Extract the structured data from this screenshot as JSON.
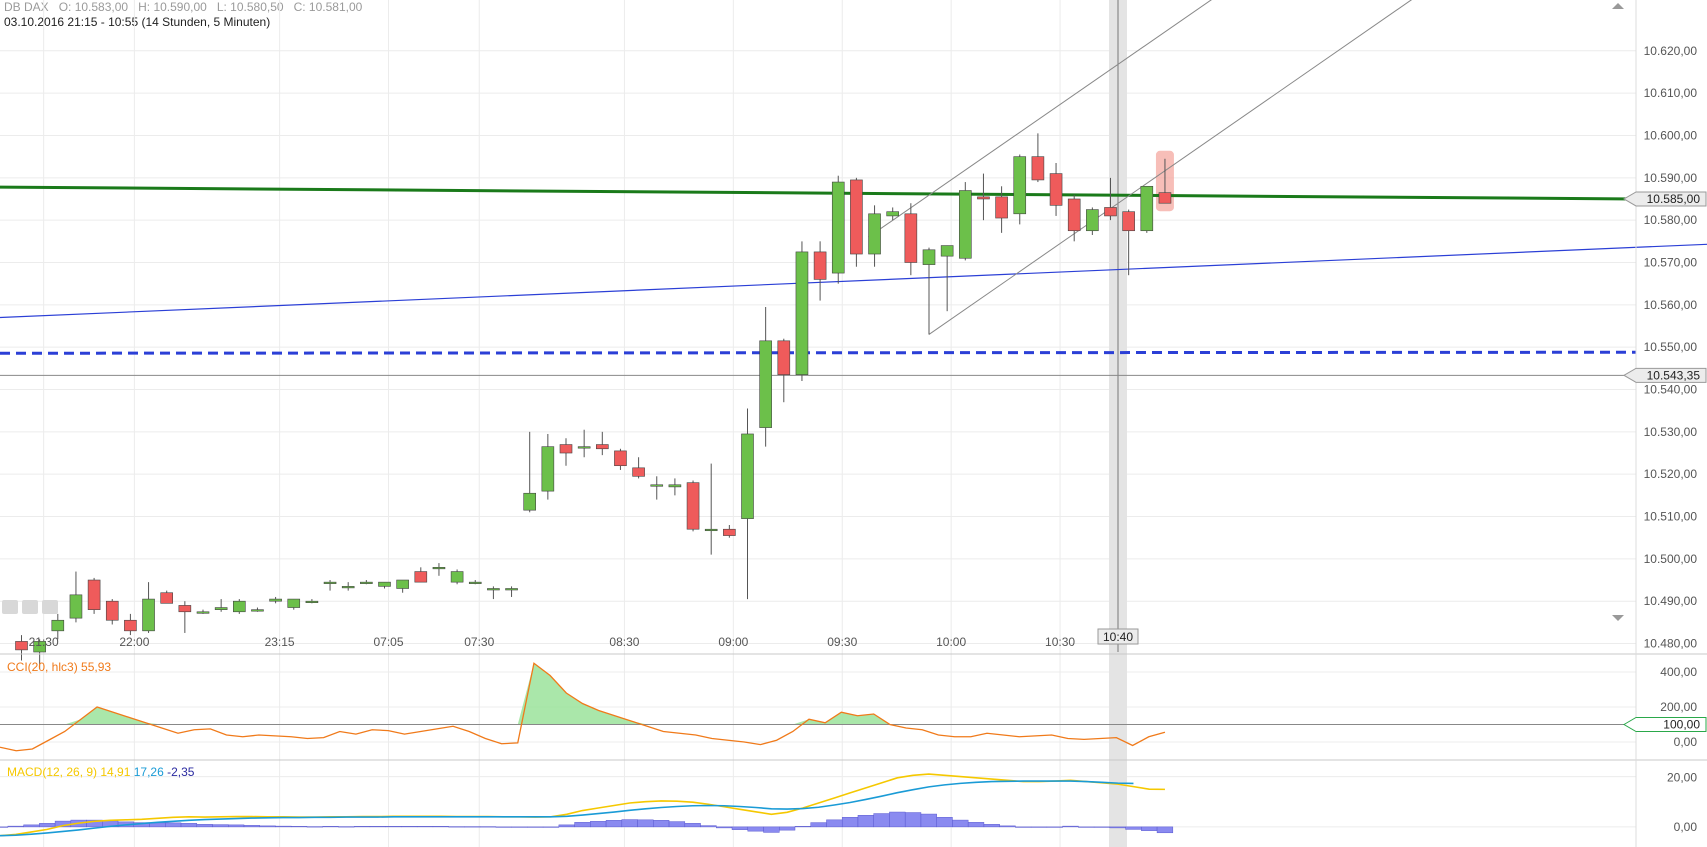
{
  "header": {
    "symbol": "DB DAX",
    "open": "O: 10.583,00",
    "high": "H: 10.590,00",
    "low": "L: 10.580,50",
    "close": "C: 10.581,00",
    "range": "03.10.2016 21:15 - 10:55 (14 Stunden, 5 Minuten)"
  },
  "colors": {
    "up": "#6cc04a",
    "down": "#ef5b5b",
    "grid": "#ececec",
    "support": "#1a7a1a",
    "trend": "#2b3fd6",
    "cci": "#f07a1a",
    "cci_fill": "#9be39b",
    "macd": "#f5c800",
    "signal": "#1a9bd6",
    "hist": "#8a8af0"
  },
  "markers": {
    "crosshair_time": "10:40",
    "price_labels": [
      "10.585,00",
      "10.543,35"
    ],
    "cci_level_label": "100,00"
  },
  "chart_data": [
    {
      "type": "candlestick",
      "interval": "5 Minuten",
      "x_labels": [
        "21:30",
        "22:00",
        "23:15",
        "07:05",
        "07:30",
        "08:30",
        "09:00",
        "09:30",
        "10:00",
        "10:30"
      ],
      "y_ticks": [
        "10.480,00",
        "10.490,00",
        "10.500,00",
        "10.510,00",
        "10.520,00",
        "10.530,00",
        "10.540,00",
        "10.550,00",
        "10.560,00",
        "10.570,00",
        "10.580,00",
        "10.590,00",
        "10.600,00",
        "10.610,00",
        "10.620,00"
      ],
      "ylim": [
        10478,
        10632
      ],
      "candles": [
        {
          "o": 10480.5,
          "h": 10482,
          "l": 10476,
          "c": 10478.5
        },
        {
          "o": 10478,
          "h": 10481,
          "l": 10474,
          "c": 10480.5
        },
        {
          "o": 10483,
          "h": 10487,
          "l": 10481,
          "c": 10485.5
        },
        {
          "o": 10486,
          "h": 10497,
          "l": 10485,
          "c": 10491.5
        },
        {
          "o": 10495,
          "h": 10495.5,
          "l": 10487,
          "c": 10488
        },
        {
          "o": 10490,
          "h": 10490.5,
          "l": 10484.5,
          "c": 10485.5
        },
        {
          "o": 10485.5,
          "h": 10487,
          "l": 10482,
          "c": 10483
        },
        {
          "o": 10483,
          "h": 10494.5,
          "l": 10482.5,
          "c": 10490.5
        },
        {
          "o": 10492,
          "h": 10492.5,
          "l": 10489.5,
          "c": 10489.5
        },
        {
          "o": 10489,
          "h": 10490,
          "l": 10482.5,
          "c": 10487.5
        },
        {
          "o": 10487.5,
          "h": 10488,
          "l": 10487,
          "c": 10487.5
        },
        {
          "o": 10488,
          "h": 10490.5,
          "l": 10487.5,
          "c": 10488.5
        },
        {
          "o": 10487.5,
          "h": 10490.5,
          "l": 10487,
          "c": 10490
        },
        {
          "o": 10488,
          "h": 10488.5,
          "l": 10487.5,
          "c": 10488
        },
        {
          "o": 10490,
          "h": 10491,
          "l": 10489.5,
          "c": 10490.5
        },
        {
          "o": 10488.5,
          "h": 10490.5,
          "l": 10488,
          "c": 10490.5
        },
        {
          "o": 10490,
          "h": 10490.5,
          "l": 10489.5,
          "c": 10490
        },
        {
          "o": 10494.5,
          "h": 10495,
          "l": 10492.5,
          "c": 10494.5
        },
        {
          "o": 10493.5,
          "h": 10494.5,
          "l": 10492.5,
          "c": 10493.5
        },
        {
          "o": 10494.5,
          "h": 10495,
          "l": 10494,
          "c": 10494.5
        },
        {
          "o": 10493.5,
          "h": 10494.5,
          "l": 10493,
          "c": 10494.5
        },
        {
          "o": 10493,
          "h": 10495,
          "l": 10492,
          "c": 10495
        },
        {
          "o": 10497,
          "h": 10498,
          "l": 10494.5,
          "c": 10494.5
        },
        {
          "o": 10498,
          "h": 10499,
          "l": 10496,
          "c": 10498
        },
        {
          "o": 10494.5,
          "h": 10497.5,
          "l": 10494,
          "c": 10497
        },
        {
          "o": 10494.5,
          "h": 10495,
          "l": 10494,
          "c": 10494.5
        },
        {
          "o": 10493,
          "h": 10493.5,
          "l": 10490.5,
          "c": 10493
        },
        {
          "o": 10493,
          "h": 10493.5,
          "l": 10491,
          "c": 10493
        },
        {
          "o": 10511.5,
          "h": 10530,
          "l": 10511,
          "c": 10515.5
        },
        {
          "o": 10516,
          "h": 10529.5,
          "l": 10514,
          "c": 10526.5
        },
        {
          "o": 10527,
          "h": 10528.5,
          "l": 10522,
          "c": 10525
        },
        {
          "o": 10526.5,
          "h": 10530.5,
          "l": 10524,
          "c": 10526.5
        },
        {
          "o": 10527,
          "h": 10530,
          "l": 10524.5,
          "c": 10526
        },
        {
          "o": 10525.5,
          "h": 10526,
          "l": 10521,
          "c": 10522
        },
        {
          "o": 10521.5,
          "h": 10524,
          "l": 10519,
          "c": 10519.5
        },
        {
          "o": 10517.5,
          "h": 10519.5,
          "l": 10514,
          "c": 10517.5
        },
        {
          "o": 10517,
          "h": 10519,
          "l": 10515,
          "c": 10517.5
        },
        {
          "o": 10518,
          "h": 10518.5,
          "l": 10506.5,
          "c": 10507
        },
        {
          "o": 10507,
          "h": 10522.5,
          "l": 10501,
          "c": 10507
        },
        {
          "o": 10507,
          "h": 10508,
          "l": 10505,
          "c": 10505.5
        },
        {
          "o": 10509.5,
          "h": 10535.5,
          "l": 10490.5,
          "c": 10529.5
        },
        {
          "o": 10531,
          "h": 10559.5,
          "l": 10526.5,
          "c": 10551.5
        },
        {
          "o": 10551.5,
          "h": 10552,
          "l": 10537,
          "c": 10543.5
        },
        {
          "o": 10543.5,
          "h": 10575,
          "l": 10542,
          "c": 10572.5
        },
        {
          "o": 10572.5,
          "h": 10575,
          "l": 10561,
          "c": 10566
        },
        {
          "o": 10567.5,
          "h": 10590.5,
          "l": 10565,
          "c": 10589
        },
        {
          "o": 10589.5,
          "h": 10590,
          "l": 10569,
          "c": 10572
        },
        {
          "o": 10572,
          "h": 10583.5,
          "l": 10569,
          "c": 10581.5
        },
        {
          "o": 10581,
          "h": 10583,
          "l": 10580,
          "c": 10582
        },
        {
          "o": 10581.5,
          "h": 10584,
          "l": 10567,
          "c": 10570
        },
        {
          "o": 10569.5,
          "h": 10573.5,
          "l": 10553,
          "c": 10573
        },
        {
          "o": 10571.5,
          "h": 10574,
          "l": 10558.5,
          "c": 10574
        },
        {
          "o": 10571,
          "h": 10589,
          "l": 10570.5,
          "c": 10587
        },
        {
          "o": 10585.5,
          "h": 10591,
          "l": 10580,
          "c": 10585
        },
        {
          "o": 10585.5,
          "h": 10588,
          "l": 10577,
          "c": 10580.5
        },
        {
          "o": 10581.5,
          "h": 10595.5,
          "l": 10579,
          "c": 10595
        },
        {
          "o": 10595,
          "h": 10600.5,
          "l": 10589,
          "c": 10589.5
        },
        {
          "o": 10591,
          "h": 10593.5,
          "l": 10581,
          "c": 10583.5
        },
        {
          "o": 10585,
          "h": 10586,
          "l": 10575,
          "c": 10577.5
        },
        {
          "o": 10577.5,
          "h": 10583,
          "l": 10576.5,
          "c": 10582.5
        },
        {
          "o": 10583,
          "h": 10590,
          "l": 10580,
          "c": 10581
        },
        {
          "o": 10582,
          "h": 10582.5,
          "l": 10567,
          "c": 10577.5
        },
        {
          "o": 10577.5,
          "h": 10588,
          "l": 10577,
          "c": 10588
        },
        {
          "o": 10586.5,
          "h": 10594.5,
          "l": 10584,
          "c": 10584
        }
      ],
      "lines": {
        "support_horizontal": {
          "from": 10587.8,
          "to": 10585
        },
        "trend_rising": {
          "from": 10557,
          "to": 10574.3
        },
        "dashed_level": {
          "value": 10548.8
        },
        "last_close_level": {
          "value": 10543.35
        }
      }
    },
    {
      "type": "line",
      "label": "CCI(20, hlc3)",
      "last_value": "55,93",
      "y_ticks": [
        "0,00",
        "200,00",
        "400,00"
      ],
      "ylim": [
        -80,
        480
      ],
      "reference_level": 100,
      "values": [
        -30,
        -50,
        -40,
        10,
        60,
        130,
        200,
        170,
        140,
        110,
        80,
        50,
        70,
        75,
        40,
        30,
        40,
        35,
        30,
        20,
        25,
        60,
        45,
        70,
        65,
        45,
        60,
        75,
        90,
        60,
        20,
        -10,
        -5,
        450,
        380,
        280,
        220,
        180,
        150,
        120,
        90,
        60,
        50,
        40,
        20,
        10,
        0,
        -15,
        10,
        60,
        130,
        110,
        170,
        150,
        160,
        100,
        80,
        70,
        40,
        30,
        30,
        50,
        40,
        30,
        35,
        40,
        20,
        15,
        20,
        25,
        -20,
        30,
        55.93
      ]
    },
    {
      "type": "line",
      "label": "MACD(12, 26, 9)",
      "values_text": [
        "14,91",
        "17,26",
        "-2,35"
      ],
      "y_ticks": [
        "0,00",
        "20,00"
      ],
      "ylim": [
        -8,
        25
      ],
      "series": [
        {
          "name": "MACD",
          "values": [
            -3.5,
            -3,
            -2,
            -1,
            0.5,
            1.5,
            2.2,
            2.6,
            2.8,
            3,
            3.4,
            3.8,
            4,
            3.9,
            4,
            4.1,
            4.1,
            4,
            4,
            3.9,
            3.9,
            4,
            4,
            4.1,
            4.1,
            4.2,
            4.2,
            4.2,
            4.2,
            4.1,
            4.1,
            4.1,
            4,
            4,
            3.9,
            4,
            5,
            6.5,
            7.5,
            8.5,
            9.5,
            10,
            10.3,
            10.2,
            9.8,
            9,
            8,
            7,
            6,
            5,
            5.8,
            7.5,
            9.5,
            11.5,
            13.5,
            15.5,
            17.5,
            19.5,
            20.5,
            21,
            20.5,
            20,
            19.5,
            19,
            18.5,
            18,
            18,
            18.2,
            18.5,
            18,
            17.5,
            17,
            16,
            15,
            14.91
          ]
        },
        {
          "name": "Signal",
          "values": [
            -3.5,
            -3.3,
            -2.9,
            -2.4,
            -1.8,
            -1.2,
            -0.5,
            0.2,
            0.8,
            1.3,
            1.8,
            2.2,
            2.6,
            2.9,
            3.1,
            3.3,
            3.5,
            3.6,
            3.7,
            3.7,
            3.8,
            3.8,
            3.9,
            3.9,
            3.9,
            4,
            4,
            4,
            4,
            4,
            4,
            4,
            4,
            4,
            4,
            4,
            4.2,
            4.7,
            5.3,
            5.9,
            6.6,
            7.2,
            7.7,
            8.1,
            8.4,
            8.5,
            8.4,
            8.1,
            7.7,
            7.2,
            7.1,
            7.3,
            7.8,
            8.7,
            9.7,
            10.9,
            12.2,
            13.6,
            14.8,
            15.9,
            16.7,
            17.3,
            17.7,
            18,
            18.1,
            18.2,
            18.2,
            18.2,
            18.2,
            18,
            17.7,
            17.4,
            17.26
          ]
        }
      ],
      "histogram": [
        0,
        0.3,
        0.8,
        1.4,
        2.3,
        2.7,
        2.7,
        2.4,
        2,
        1.7,
        1.6,
        1.6,
        1.4,
        1,
        0.9,
        0.8,
        0.6,
        0.4,
        0.3,
        0.2,
        0.1,
        0.2,
        0.1,
        0.2,
        0.2,
        0.2,
        0.2,
        0.2,
        0.2,
        0.1,
        0.1,
        0.1,
        0,
        0,
        -0.1,
        0,
        0.8,
        1.8,
        2.2,
        2.6,
        2.9,
        2.8,
        2.6,
        2.1,
        1.4,
        0.5,
        -0.4,
        -1.1,
        -1.7,
        -2.2,
        -1.3,
        0.2,
        1.7,
        2.8,
        3.8,
        4.6,
        5.3,
        5.9,
        5.7,
        5.1,
        3.8,
        2.7,
        1.8,
        1,
        0.4,
        -0.2,
        -0.2,
        0,
        0.3,
        0,
        -0.2,
        -0.4,
        -1,
        -1.5,
        -2.35
      ]
    }
  ]
}
